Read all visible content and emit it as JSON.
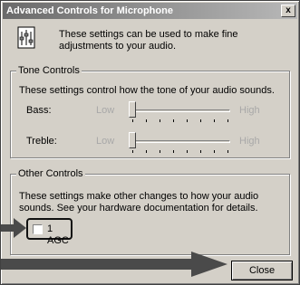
{
  "window": {
    "title": "Advanced Controls for Microphone",
    "close_glyph": "x"
  },
  "intro": {
    "icon": "settings-sheet-icon",
    "text": "These settings can be used to make fine adjustments to your audio."
  },
  "tone_controls": {
    "legend": "Tone Controls",
    "description": "These settings control how the tone of your audio sounds.",
    "sliders": [
      {
        "label": "Bass:",
        "low": "Low",
        "high": "High",
        "value": 0.0
      },
      {
        "label": "Treble:",
        "low": "Low",
        "high": "High",
        "value": 0.0
      }
    ]
  },
  "other_controls": {
    "legend": "Other Controls",
    "description": "These settings make other changes to how your audio sounds.  See your hardware documentation for details.",
    "agc": {
      "label": "1  AGC",
      "checked": false
    }
  },
  "footer": {
    "close_label": "Close"
  },
  "annotations": {
    "arrow_color": "#4a4a4a",
    "arrows": [
      "arrow-to-agc",
      "arrow-to-close"
    ]
  }
}
